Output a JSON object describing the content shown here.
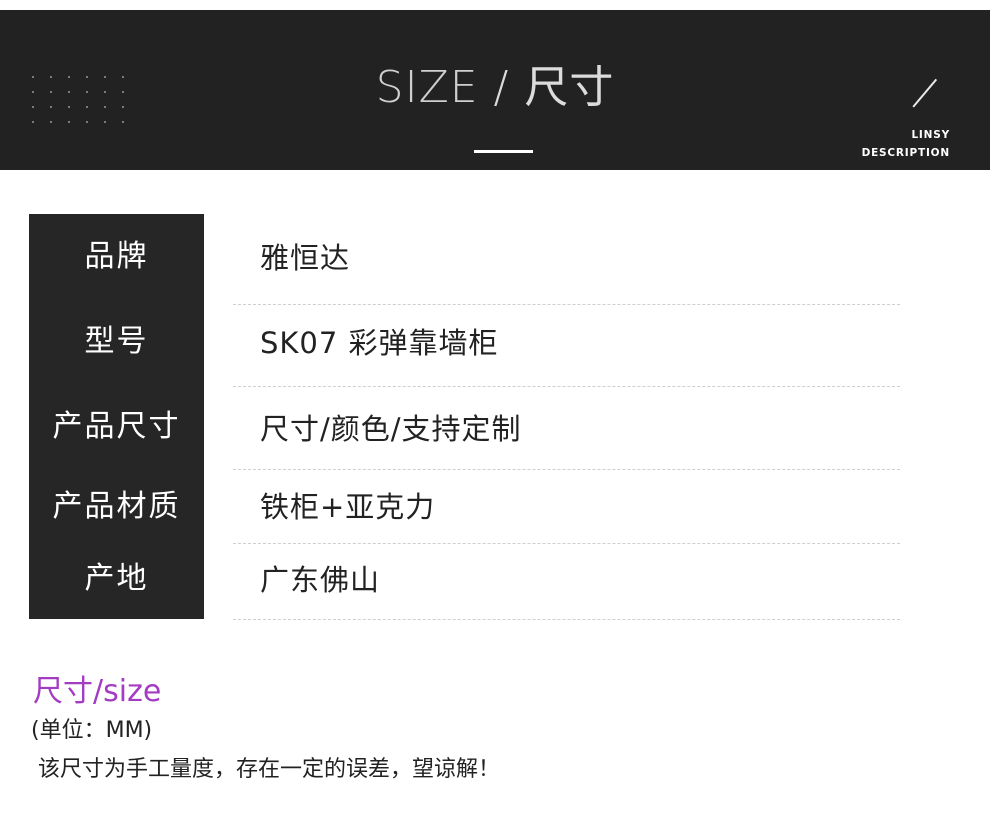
{
  "banner": {
    "title_en": "SIZE",
    "title_sep": " / ",
    "title_cn": "尺寸",
    "brand_line1": "LINSY",
    "brand_line2": "DESCRIPTION",
    "colors": {
      "background": "#222222",
      "text": "#dcdcdc"
    }
  },
  "specs": [
    {
      "label": "品牌",
      "value": "雅恒达"
    },
    {
      "label": "型号",
      "value": "SK07 彩弹靠墙柜"
    },
    {
      "label": "产品尺寸",
      "value": "尺寸/颜色/支持定制"
    },
    {
      "label": "产品材质",
      "value": "铁柜+亚克力"
    },
    {
      "label": "产地",
      "value": "广东佛山"
    }
  ],
  "size_section": {
    "heading": "尺寸/size",
    "unit": "(单位：MM)",
    "note": "该尺寸为手工量度，存在一定的误差，望谅解！",
    "heading_color": "#a43bc3"
  }
}
